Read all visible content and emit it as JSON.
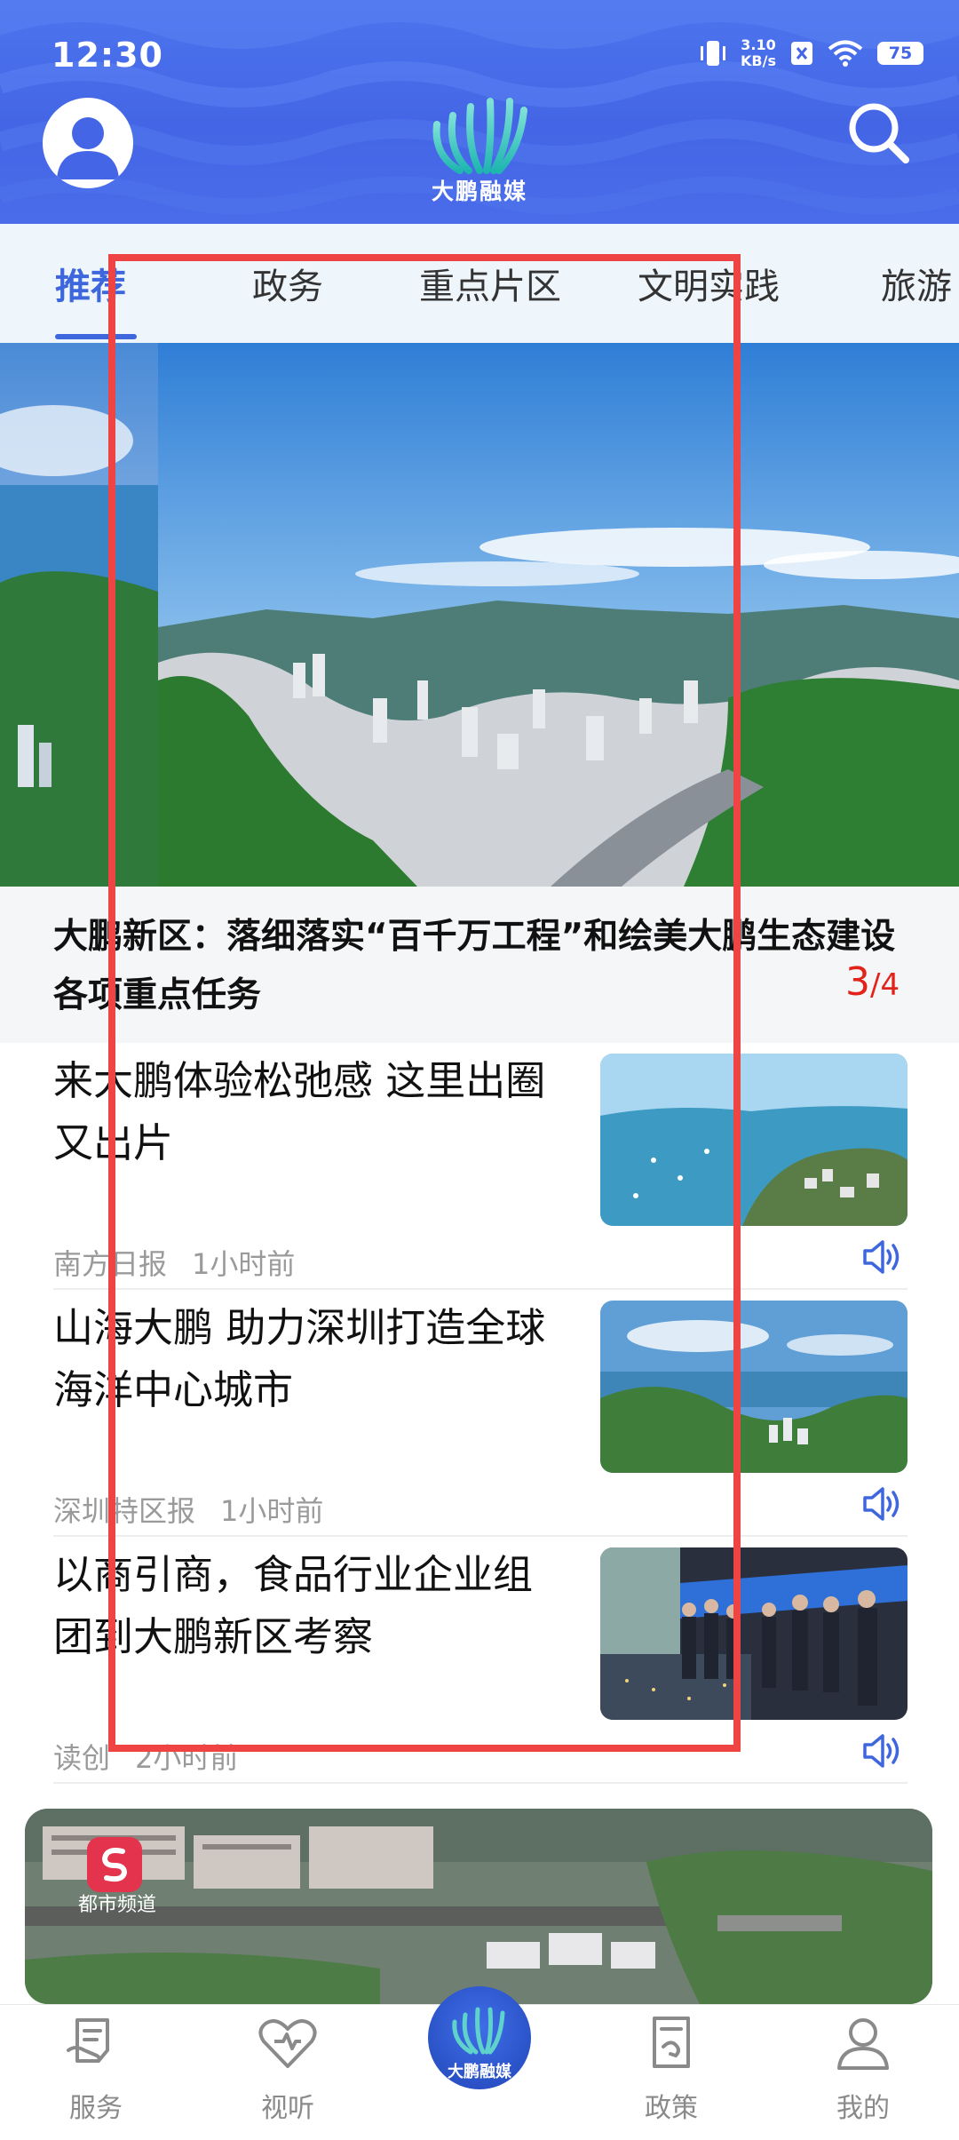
{
  "status_bar": {
    "time": "12:30",
    "net_speed_value": "3.10",
    "net_speed_unit": "KB/s",
    "battery": "75",
    "icons": [
      "vibrate-icon",
      "notification-icon",
      "wifi-icon",
      "battery-icon"
    ]
  },
  "header": {
    "logo_text": "大鹏融媒",
    "icons": [
      "avatar-icon",
      "search-icon"
    ]
  },
  "tabs": [
    {
      "label": "推荐",
      "active": true
    },
    {
      "label": "政务",
      "active": false
    },
    {
      "label": "重点片区",
      "active": false
    },
    {
      "label": "文明实践",
      "active": false
    },
    {
      "label": "旅游",
      "active": false
    }
  ],
  "banner": {
    "title": "大鹏新区：落细落实“百千万工程”和绘美大鹏生态建设各项重点任务",
    "page_current": "3",
    "page_total": "/4"
  },
  "news": [
    {
      "title": "来大鹏体验松弛感 这里出圈又出片",
      "source": "南方日报",
      "time": "1小时前"
    },
    {
      "title": "山海大鹏 助力深圳打造全球海洋中心城市",
      "source": "深圳特区报",
      "time": "1小时前"
    },
    {
      "title": "以商引商，食品行业企业组团到大鹏新区考察",
      "source": "读创",
      "time": "2小时前"
    }
  ],
  "video_card": {
    "channel_label": "都市频道"
  },
  "bottom_nav": [
    {
      "label": "服务",
      "icon": "service-icon"
    },
    {
      "label": "视听",
      "icon": "heart-icon"
    },
    {
      "label": "大鹏融媒",
      "icon": "center-logo-icon"
    },
    {
      "label": "政策",
      "icon": "policy-icon"
    },
    {
      "label": "我的",
      "icon": "user-icon"
    }
  ],
  "colors": {
    "header_blue": "#4466e6",
    "tab_active": "#3e66dd",
    "page_indicator": "#e2231a",
    "highlight_box": "#ee4444"
  }
}
